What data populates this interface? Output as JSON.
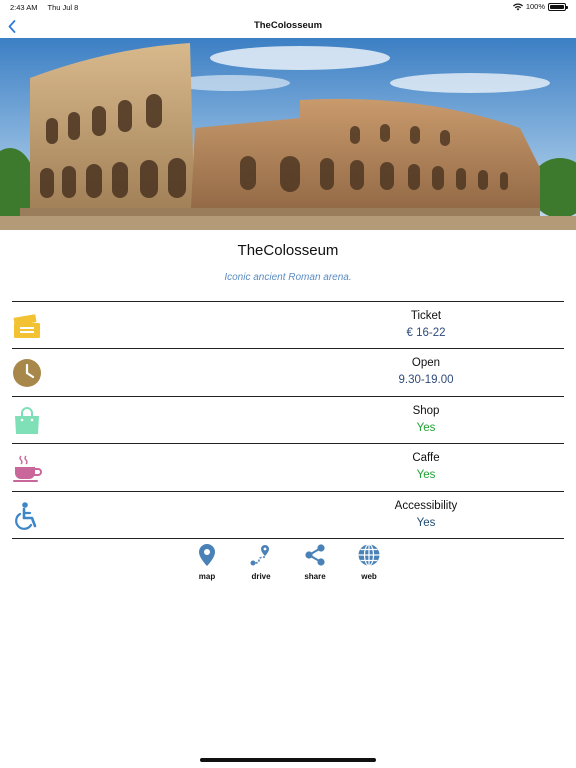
{
  "status_bar": {
    "time": "2:43 AM",
    "date": "Thu Jul 8",
    "battery": "100%",
    "wifi_icon": "wifi-icon",
    "battery_icon": "battery-icon"
  },
  "nav": {
    "title": "TheColosseum",
    "back_icon": "chevron-left-icon"
  },
  "hero": {
    "image": "colosseum-photo"
  },
  "place": {
    "title": "TheColosseum",
    "subtitle": "Iconic ancient Roman arena."
  },
  "info": [
    {
      "label": "Ticket",
      "value": "€ 16-22",
      "icon": "ticket-icon",
      "icon_color": "#f2c233"
    },
    {
      "label": "Open",
      "value": "9.30-19.00",
      "icon": "clock-icon",
      "icon_color": "#a8884a"
    },
    {
      "label": "Shop",
      "value": "Yes",
      "icon": "shopping-bag-icon",
      "icon_color": "#7fe0b8"
    },
    {
      "label": "Caffe",
      "value": "Yes",
      "icon": "coffee-cup-icon",
      "icon_color": "#c9669a"
    },
    {
      "label": "Accessibility",
      "value": "Yes",
      "icon": "wheelchair-icon",
      "icon_color": "#3d87c9"
    }
  ],
  "actions": [
    {
      "label": "map",
      "icon": "map-pin-icon"
    },
    {
      "label": "drive",
      "icon": "route-icon"
    },
    {
      "label": "share",
      "icon": "share-icon"
    },
    {
      "label": "web",
      "icon": "globe-icon"
    }
  ],
  "colors": {
    "accent": "#3d7fbf",
    "action_icon": "#4a82b8",
    "subtitle": "#5b8cc2",
    "green": "#21a336"
  }
}
